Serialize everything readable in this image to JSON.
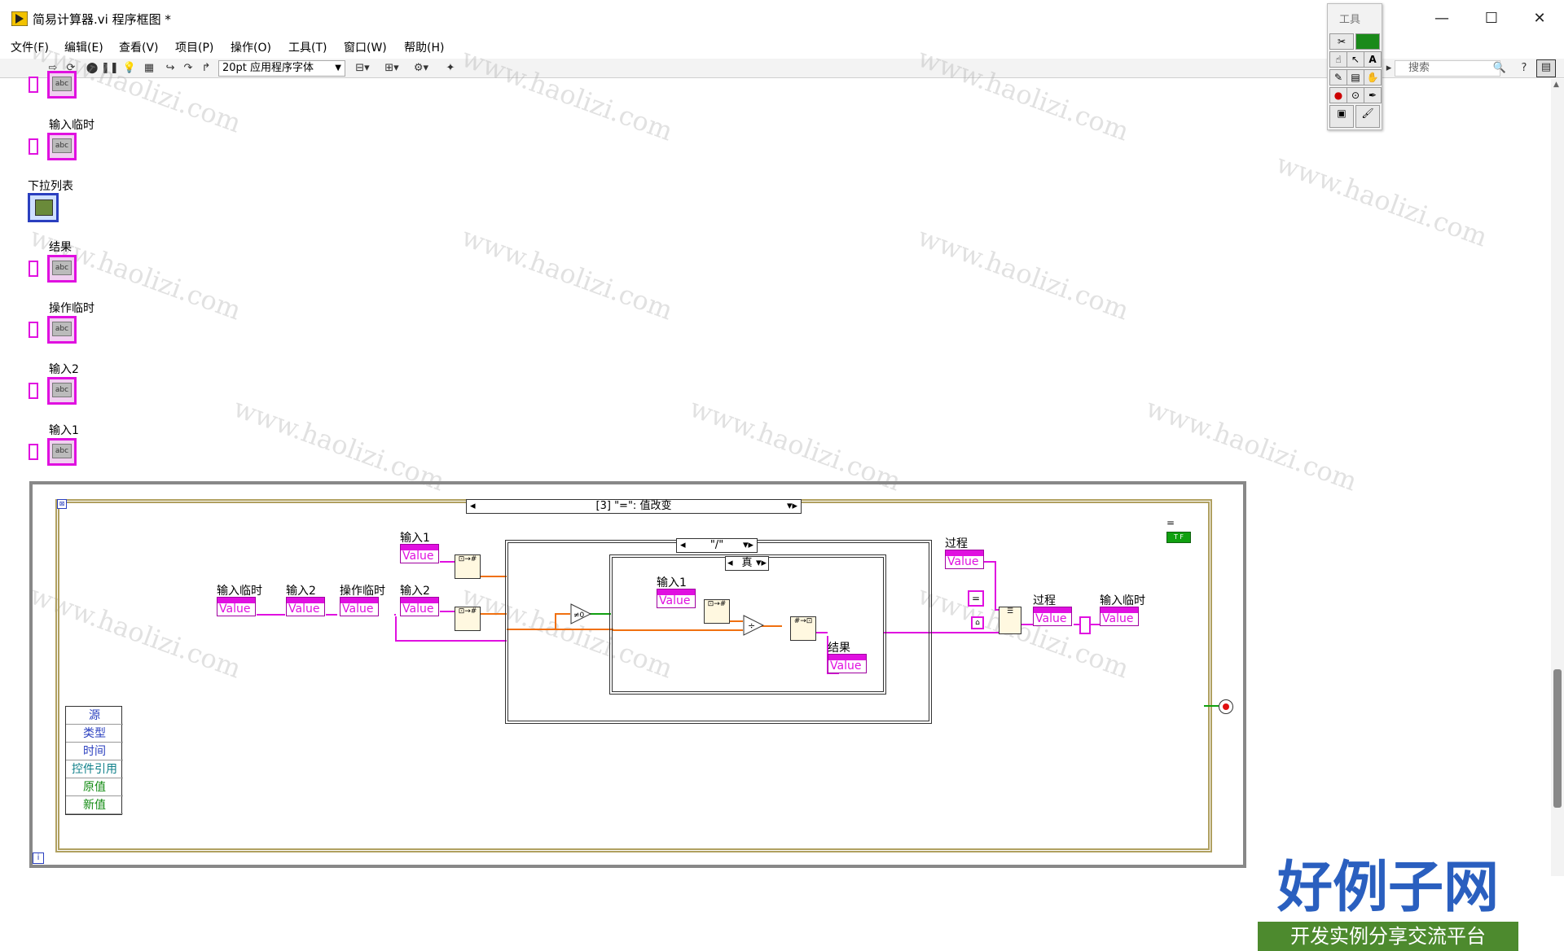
{
  "window": {
    "title": "简易计算器.vi 程序框图 *",
    "minimize": "—",
    "maximize": "☐",
    "close": "✕"
  },
  "menu": [
    "文件(F)",
    "编辑(E)",
    "查看(V)",
    "项目(P)",
    "操作(O)",
    "工具(T)",
    "窗口(W)",
    "帮助(H)"
  ],
  "toolbar": {
    "font": "20pt 应用程序字体",
    "search_placeholder": "搜索"
  },
  "tools_palette": {
    "title": "工具",
    "labels": [
      "A"
    ]
  },
  "terminals": [
    {
      "label": ""
    },
    {
      "label": "输入临时"
    },
    {
      "label": "下拉列表"
    },
    {
      "label": "结果"
    },
    {
      "label": "操作临时"
    },
    {
      "label": "输入2"
    },
    {
      "label": "输入1"
    }
  ],
  "event_structure": {
    "selector": "[3] \"=\": 值改变",
    "inner_case": "\"/\"",
    "inner_bool_case": "真",
    "event_data": [
      "源",
      "类型",
      "时间",
      "控件引用",
      "原值",
      "新值"
    ],
    "eq_label": "="
  },
  "nodes": {
    "input_temp": {
      "label": "输入临时",
      "value": "Value"
    },
    "input2_a": {
      "label": "输入2",
      "value": "Value"
    },
    "op_temp": {
      "label": "操作临时",
      "value": "Value"
    },
    "input2_b": {
      "label": "输入2",
      "value": "Value"
    },
    "input1_top": {
      "label": "输入1",
      "value": "Value"
    },
    "input1_inner": {
      "label": "输入1",
      "value": "Value"
    },
    "result": {
      "label": "结果",
      "value": "Value"
    },
    "process_top": {
      "label": "过程",
      "value": "Value"
    },
    "process_right": {
      "label": "过程",
      "value": "Value"
    },
    "input_temp_right": {
      "label": "输入临时",
      "value": "Value"
    }
  },
  "watermark": "www.haolizi.com",
  "logo": {
    "main": "好例子网",
    "sub": "开发实例分享交流平台"
  },
  "colors": {
    "string_wire": "#e010e0",
    "numeric_wire": "#f07010",
    "bool_wire": "#10a010",
    "logo_blue": "#2a5fbf",
    "logo_green": "#4d8a2e"
  }
}
